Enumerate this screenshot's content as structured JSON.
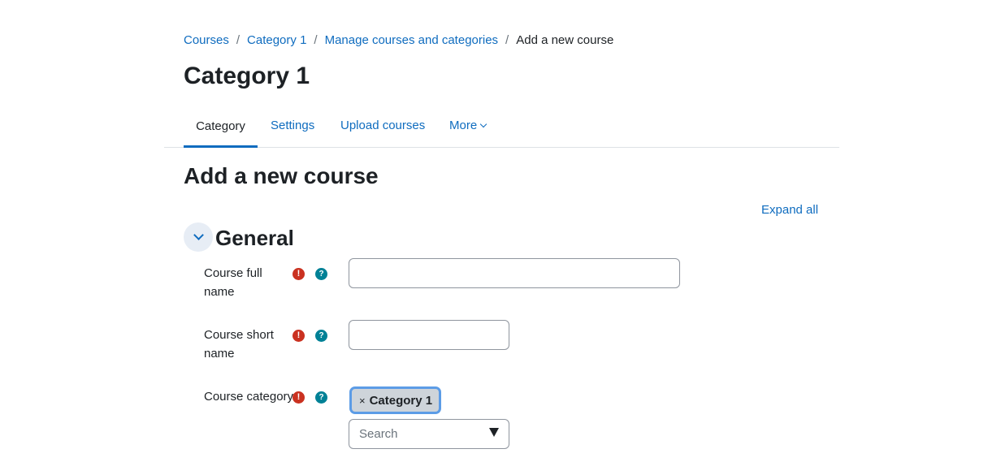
{
  "breadcrumb": {
    "items": [
      "Courses",
      "Category 1",
      "Manage courses and categories"
    ],
    "separator": "/",
    "current": "Add a new course"
  },
  "page_title": "Category 1",
  "tabs": [
    {
      "label": "Category",
      "active": true
    },
    {
      "label": "Settings",
      "active": false
    },
    {
      "label": "Upload courses",
      "active": false
    },
    {
      "label": "More",
      "active": false
    }
  ],
  "section_title": "Add a new course",
  "expand_all_label": "Expand all",
  "general": {
    "legend": "General",
    "fields": {
      "full_name": {
        "label_line1": "Course full",
        "label_line2": "name",
        "value": ""
      },
      "short_name": {
        "label_line1": "Course short",
        "label_line2": "name",
        "value": ""
      },
      "category": {
        "label": "Course category",
        "selected_tag": "Category 1",
        "remove_glyph": "×",
        "search_placeholder": "Search"
      }
    },
    "required_glyph": "!",
    "help_glyph": "?"
  },
  "colors": {
    "link": "#0f6cbf",
    "required": "#ca3120",
    "help": "#008196",
    "chip_bg": "#ced4da",
    "chip_border": "#5c9ce6"
  },
  "icons": {
    "required": "exclamation-circle-icon",
    "help": "question-circle-icon",
    "collapse": "chevron-down-icon",
    "more": "chevron-down-icon",
    "select": "caret-down-icon"
  }
}
